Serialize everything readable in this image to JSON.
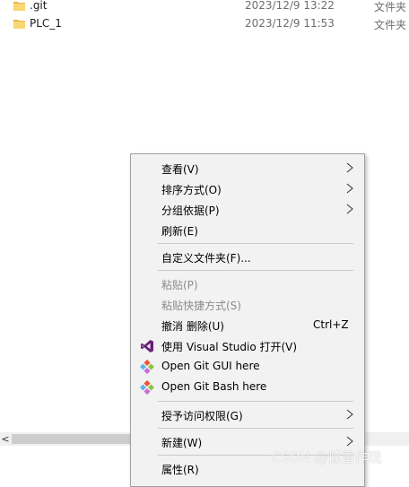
{
  "files": [
    {
      "name": ".git",
      "modified": "2023/12/9 13:22",
      "type": "文件夹"
    },
    {
      "name": "PLC_1",
      "modified": "2023/12/9 11:53",
      "type": "文件夹"
    }
  ],
  "scrollbar": {
    "left_arrow": "<"
  },
  "context_menu": {
    "items": [
      {
        "label": "查看(V)",
        "submenu": true
      },
      {
        "label": "排序方式(O)",
        "submenu": true
      },
      {
        "label": "分组依据(P)",
        "submenu": true
      },
      {
        "label": "刷新(E)"
      },
      {
        "label": "自定义文件夹(F)..."
      },
      {
        "label": "粘贴(P)",
        "disabled": true
      },
      {
        "label": "粘贴快捷方式(S)",
        "disabled": true
      },
      {
        "label": "撤消 删除(U)",
        "shortcut": "Ctrl+Z"
      },
      {
        "label": "使用 Visual Studio 打开(V)",
        "icon": "visual-studio-icon"
      },
      {
        "label": "Open Git GUI here",
        "icon": "git-gui-icon"
      },
      {
        "label": "Open Git Bash here",
        "icon": "git-bash-icon"
      },
      {
        "label": "授予访问权限(G)",
        "submenu": true
      },
      {
        "label": "新建(W)",
        "submenu": true
      },
      {
        "label": "属性(R)"
      }
    ]
  },
  "colors": {
    "folder": "#f8d775",
    "visual_studio": "#68217a",
    "menu_bg": "#f2f2f2"
  },
  "watermark": "CSDN @惊雷作现"
}
